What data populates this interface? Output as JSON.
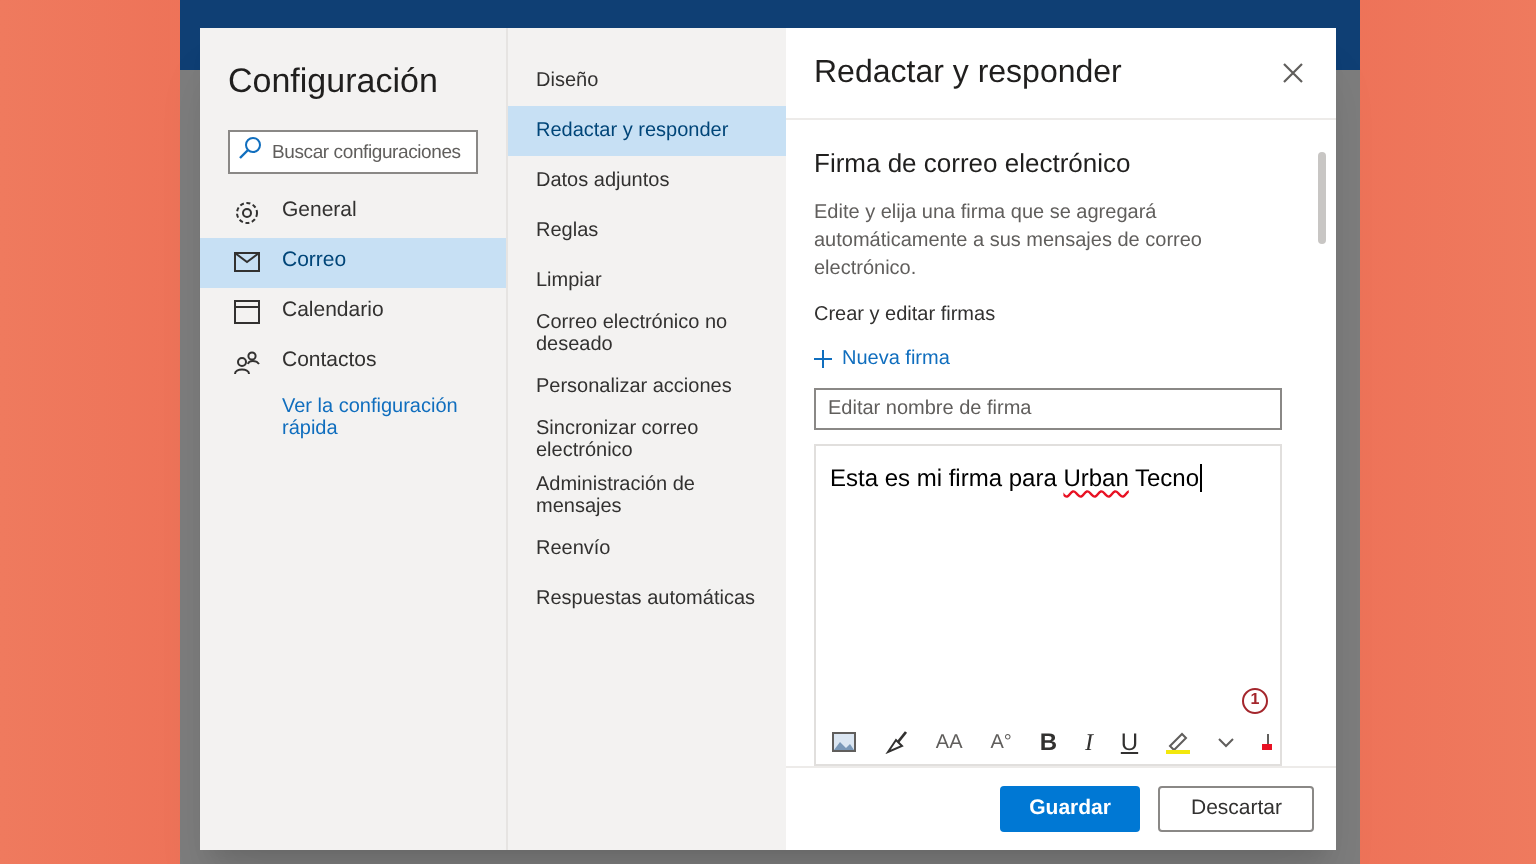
{
  "dialog": {
    "title": "Configuración",
    "search": {
      "placeholder": "Buscar configuraciones"
    },
    "categories": [
      {
        "kind": "gear",
        "label": "General",
        "selected": false
      },
      {
        "kind": "mail",
        "label": "Correo",
        "selected": true
      },
      {
        "kind": "calendar",
        "label": "Calendario",
        "selected": false
      },
      {
        "kind": "people",
        "label": "Contactos",
        "selected": false
      }
    ],
    "quick_link": "Ver la configuración rápida",
    "subsections": [
      {
        "label": "Diseño",
        "selected": false
      },
      {
        "label": "Redactar y responder",
        "selected": true
      },
      {
        "label": "Datos adjuntos",
        "selected": false
      },
      {
        "label": "Reglas",
        "selected": false
      },
      {
        "label": "Limpiar",
        "selected": false
      },
      {
        "label": "Correo electrónico no deseado",
        "selected": false
      },
      {
        "label": "Personalizar acciones",
        "selected": false
      },
      {
        "label": "Sincronizar correo electrónico",
        "selected": false
      },
      {
        "label": "Administración de mensajes",
        "selected": false
      },
      {
        "label": "Reenvío",
        "selected": false
      },
      {
        "label": "Respuestas automáticas",
        "selected": false
      }
    ],
    "panel": {
      "title": "Redactar y responder",
      "section_title": "Firma de correo electrónico",
      "description": "Edite y elija una firma que se agregará automáticamente a sus mensajes de correo electrónico.",
      "subheading": "Crear y editar firmas",
      "new_link": "Nueva firma",
      "name_field": {
        "placeholder": "Editar nombre de firma"
      },
      "editor": {
        "before": "Esta es mi firma para ",
        "misspelled": "Urban",
        "after": " Tecno",
        "counter": "1"
      },
      "toolbar": [
        {
          "kind": "image"
        },
        {
          "kind": "painter"
        },
        {
          "kind": "glyph",
          "text": "AA"
        },
        {
          "kind": "glyph",
          "text": "A°"
        },
        {
          "kind": "bold",
          "text": "B"
        },
        {
          "kind": "italic",
          "text": "I"
        },
        {
          "kind": "underline",
          "text": "U"
        },
        {
          "kind": "highlight"
        },
        {
          "kind": "chevron"
        },
        {
          "kind": "fontcolor"
        }
      ],
      "buttons": [
        {
          "label": "Guardar",
          "primary": true
        },
        {
          "label": "Descartar",
          "primary": false
        }
      ]
    }
  }
}
